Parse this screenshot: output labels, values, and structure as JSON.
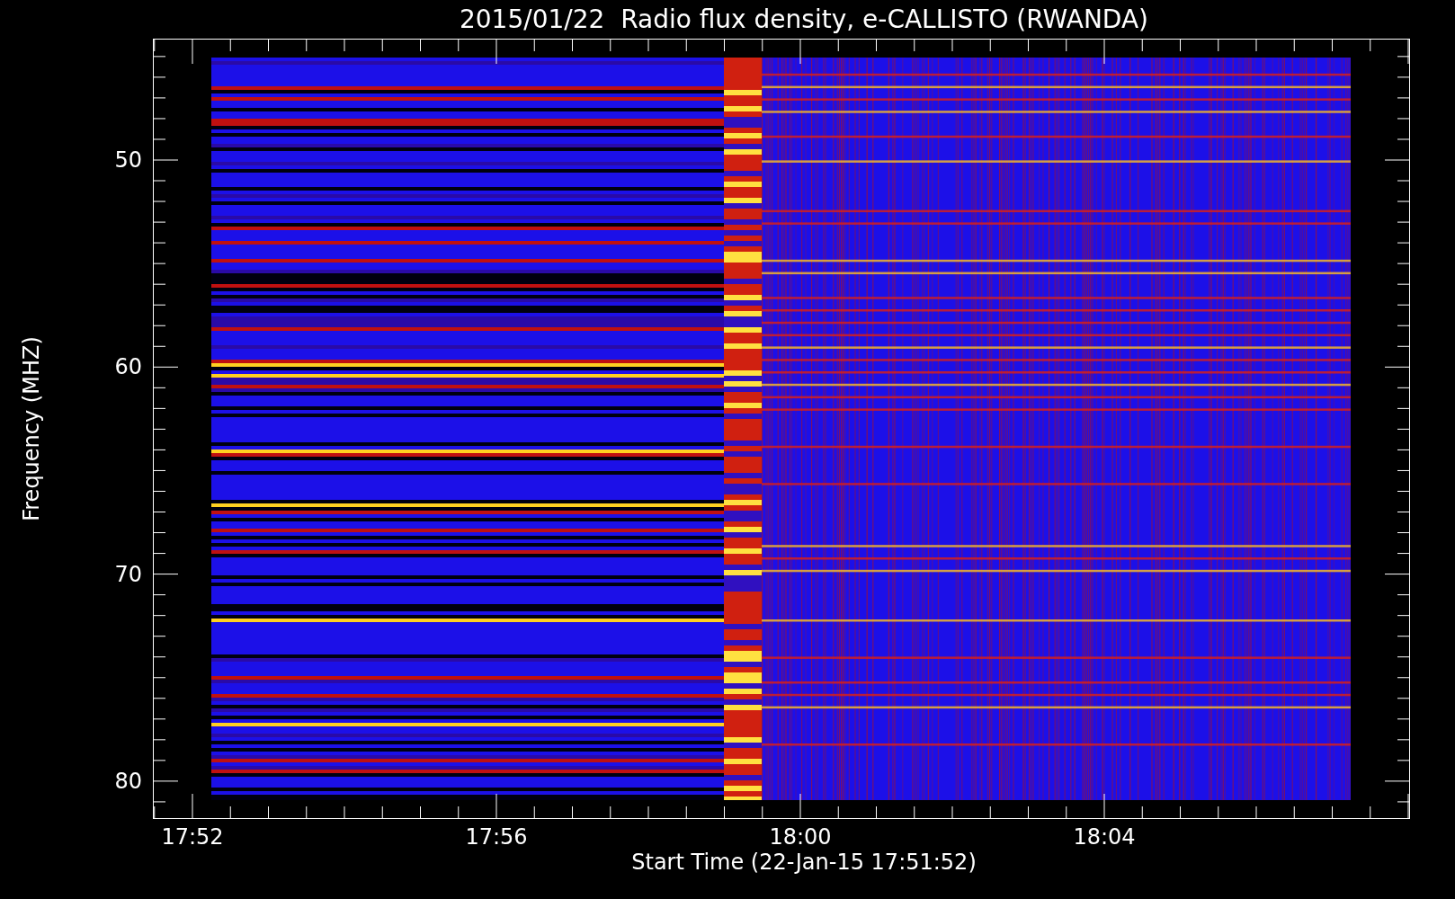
{
  "title": "2015/01/22  Radio flux density, e-CALLISTO (RWANDA)",
  "y_axis": {
    "label": "Frequency (MHZ)",
    "ticks": [
      "50",
      "60",
      "70",
      "80"
    ]
  },
  "x_axis": {
    "label": "Start Time (22-Jan-15 17:51:52)",
    "ticks": [
      "17:52",
      "17:56",
      "18:00",
      "18:04"
    ]
  }
}
